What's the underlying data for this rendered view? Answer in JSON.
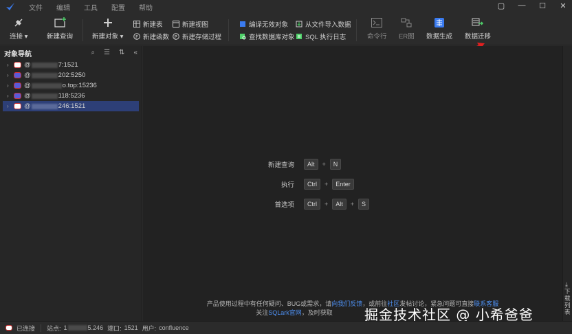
{
  "menu": {
    "items": [
      "文件",
      "编辑",
      "工具",
      "配置",
      "帮助"
    ]
  },
  "window_controls": [
    "▢",
    "—",
    "☐",
    "✕"
  ],
  "toolbar": {
    "connect": "连接",
    "new_query": "新建查询",
    "new_object": "新建对象",
    "new_table": "新建表",
    "new_function": "新建函数",
    "new_view": "新建视图",
    "new_procedure": "新建存储过程",
    "compile_invalid": "编译无效对象",
    "find_object": "查找数据库对象",
    "import_file": "从文件导入数据",
    "sql_log": "SQL 执行日志",
    "command_line": "命令行",
    "er_diagram": "ER图",
    "data_generate": "数据生成",
    "data_migrate": "数据迁移"
  },
  "sidebar": {
    "title": "对象导航",
    "connections": [
      {
        "prefix": "@",
        "suffix": "7:1521",
        "icon": "oracle",
        "selected": false
      },
      {
        "prefix": "@",
        "suffix": "202:5250",
        "icon": "dameng",
        "selected": false
      },
      {
        "prefix": "@",
        "suffix": "o.top:15236",
        "icon": "dameng",
        "selected": false
      },
      {
        "prefix": "@",
        "suffix": "118:5236",
        "icon": "dameng",
        "selected": false
      },
      {
        "prefix": "@",
        "suffix": "246:1521",
        "icon": "oracle",
        "selected": true
      }
    ]
  },
  "shortcuts": [
    {
      "label": "新建查询",
      "keys": [
        "Alt",
        "N"
      ]
    },
    {
      "label": "执行",
      "keys": [
        "Ctrl",
        "Enter"
      ]
    },
    {
      "label": "首选项",
      "keys": [
        "Ctrl",
        "Alt",
        "S"
      ]
    }
  ],
  "footer": {
    "line1_a": "产品使用过程中有任何疑问、BUG或需求，请",
    "line1_link1": "向我们反馈",
    "line1_b": "，或前往",
    "line1_link2": "社区",
    "line1_c": "发帖讨论，紧急问题可直接",
    "line1_link3": "联系客服",
    "line2_a": "关注",
    "line2_link": "SQLark官网",
    "line2_b": "，及时获取"
  },
  "right_rail": {
    "label": "下载列表"
  },
  "status": {
    "connected": "已连接",
    "site_label": "站点:",
    "site_value_a": "1",
    "site_value_b": "5.246",
    "port_label": "端口:",
    "port_value": "1521",
    "user_label": "用户:",
    "user_value": "confluence"
  },
  "watermark": "掘金技术社区 @ 小希爸爸",
  "colors": {
    "accent_blue": "#2d3f77",
    "link": "#4d8ff0",
    "oracle_red": "#d23030",
    "arrow_red": "#e02020"
  }
}
